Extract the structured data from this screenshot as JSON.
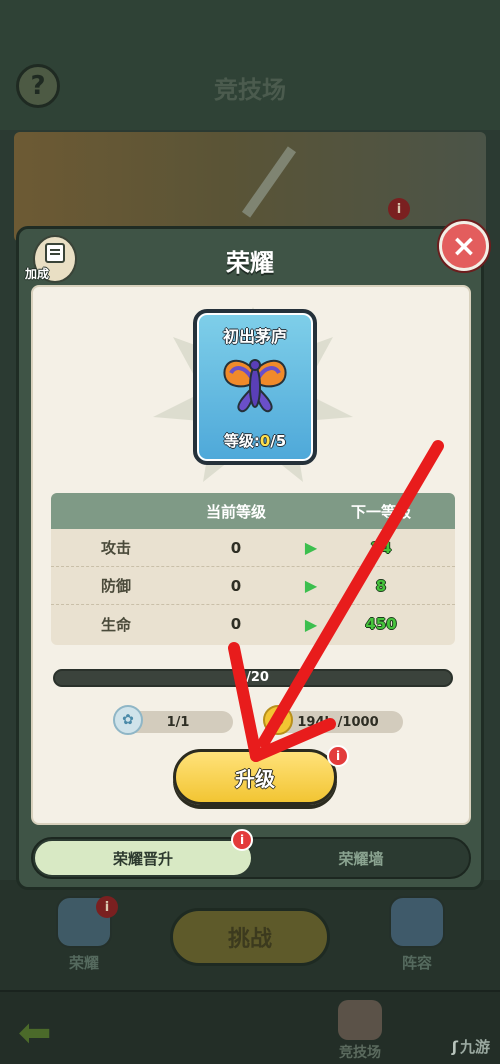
{
  "background": {
    "help_label": "?",
    "title": "竞技场",
    "tabs": [
      {
        "label": "荣耀"
      },
      {
        "label": "阵容"
      },
      {
        "label": "竞技场"
      }
    ],
    "challenge_label": "挑战",
    "watermark": "九游",
    "badge_text": "i"
  },
  "dialog": {
    "title": "荣耀",
    "bonus_label": "加成",
    "close_icon": "×",
    "card": {
      "name": "初出茅庐",
      "level_prefix": "等级:",
      "level_current": "0",
      "level_sep": "/",
      "level_max": "5"
    },
    "stats": {
      "headers": {
        "current": "当前等级",
        "next": "下一等级"
      },
      "rows": [
        {
          "name": "攻击",
          "current": "0",
          "next": "24"
        },
        {
          "name": "防御",
          "current": "0",
          "next": "8"
        },
        {
          "name": "生命",
          "current": "0",
          "next": "450"
        }
      ]
    },
    "progress": {
      "text": "0/20",
      "value": 0,
      "max": 20
    },
    "costs": [
      {
        "text": "1/1",
        "icon": "medal-icon"
      },
      {
        "text": "194k /1000",
        "icon": "coin-icon"
      }
    ],
    "upgrade_label": "升级",
    "badge_text": "i",
    "tabs": [
      {
        "label": "荣耀晋升",
        "active": true
      },
      {
        "label": "荣耀墙",
        "active": false
      }
    ]
  },
  "colors": {
    "accent_yellow": "#f2c533",
    "close_red": "#e35d5d",
    "next_green": "#46c43c",
    "annotation_red": "#e81c1c"
  }
}
